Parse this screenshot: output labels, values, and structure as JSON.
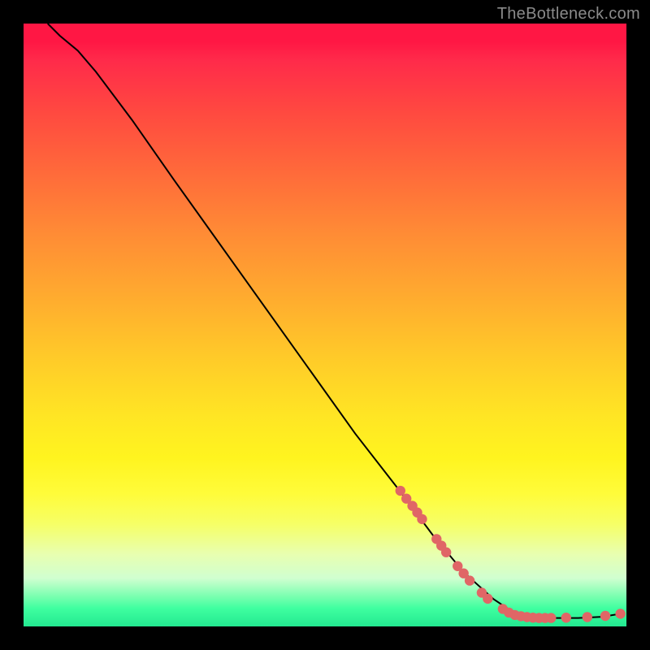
{
  "watermark": "TheBottleneck.com",
  "chart_data": {
    "type": "line",
    "title": "",
    "xlabel": "",
    "ylabel": "",
    "xlim": [
      0,
      100
    ],
    "ylim": [
      0,
      100
    ],
    "grid": false,
    "legend": false,
    "note": "No axis tick labels are rendered; values are estimated positions in percent of plot area.",
    "series": [
      {
        "name": "curve",
        "type": "line",
        "color": "#000000",
        "points": [
          {
            "x": 4,
            "y": 100
          },
          {
            "x": 6,
            "y": 98
          },
          {
            "x": 9,
            "y": 95.5
          },
          {
            "x": 12,
            "y": 92
          },
          {
            "x": 18,
            "y": 84
          },
          {
            "x": 25,
            "y": 74
          },
          {
            "x": 35,
            "y": 60
          },
          {
            "x": 45,
            "y": 46
          },
          {
            "x": 55,
            "y": 32
          },
          {
            "x": 62,
            "y": 23
          },
          {
            "x": 68,
            "y": 15
          },
          {
            "x": 73,
            "y": 9
          },
          {
            "x": 78,
            "y": 4.5
          },
          {
            "x": 81,
            "y": 2.5
          },
          {
            "x": 84,
            "y": 1.6
          },
          {
            "x": 88,
            "y": 1.4
          },
          {
            "x": 92,
            "y": 1.4
          },
          {
            "x": 96,
            "y": 1.6
          },
          {
            "x": 99,
            "y": 2.1
          }
        ]
      },
      {
        "name": "markers",
        "type": "scatter",
        "color": "#e06666",
        "points": [
          {
            "x": 62.5,
            "y": 22.5
          },
          {
            "x": 63.5,
            "y": 21.2
          },
          {
            "x": 64.5,
            "y": 20.0
          },
          {
            "x": 65.3,
            "y": 18.9
          },
          {
            "x": 66.1,
            "y": 17.8
          },
          {
            "x": 68.5,
            "y": 14.5
          },
          {
            "x": 69.3,
            "y": 13.4
          },
          {
            "x": 70.1,
            "y": 12.3
          },
          {
            "x": 72.0,
            "y": 10.0
          },
          {
            "x": 73.0,
            "y": 8.8
          },
          {
            "x": 74.0,
            "y": 7.6
          },
          {
            "x": 76.0,
            "y": 5.6
          },
          {
            "x": 77.0,
            "y": 4.6
          },
          {
            "x": 79.5,
            "y": 2.9
          },
          {
            "x": 80.5,
            "y": 2.3
          },
          {
            "x": 81.5,
            "y": 1.9
          },
          {
            "x": 82.5,
            "y": 1.7
          },
          {
            "x": 83.5,
            "y": 1.55
          },
          {
            "x": 84.5,
            "y": 1.45
          },
          {
            "x": 85.5,
            "y": 1.4
          },
          {
            "x": 86.5,
            "y": 1.4
          },
          {
            "x": 87.5,
            "y": 1.4
          },
          {
            "x": 90.0,
            "y": 1.45
          },
          {
            "x": 93.5,
            "y": 1.55
          },
          {
            "x": 96.5,
            "y": 1.75
          },
          {
            "x": 99.0,
            "y": 2.1
          }
        ]
      }
    ],
    "background": {
      "type": "vertical-gradient",
      "stops": [
        {
          "pos": 0,
          "color": "#ff1744"
        },
        {
          "pos": 50,
          "color": "#ffc929"
        },
        {
          "pos": 78,
          "color": "#fffc3a"
        },
        {
          "pos": 100,
          "color": "#23e890"
        }
      ]
    }
  }
}
